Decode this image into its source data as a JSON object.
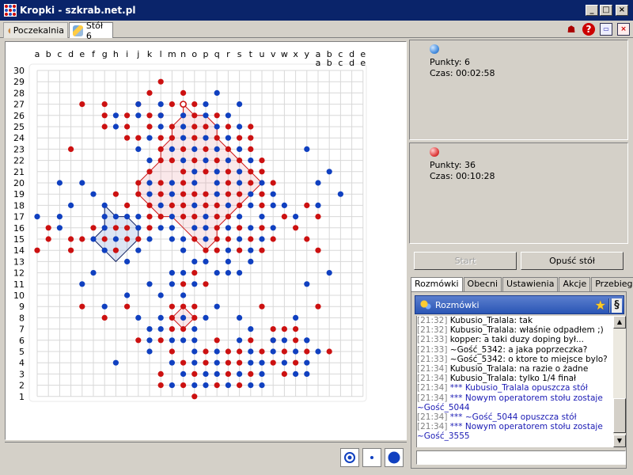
{
  "window": {
    "title": "Kropki - szkrab.net.pl",
    "minimize": "_",
    "maximize": "□",
    "close": "×"
  },
  "tabs": [
    {
      "label": "Poczekalnia"
    },
    {
      "label": "Stół 6"
    }
  ],
  "toolbar_icons": [
    "users-icon",
    "help-icon",
    "restore-window-icon",
    "close-window-icon"
  ],
  "board": {
    "columns": [
      "a",
      "b",
      "c",
      "d",
      "e",
      "f",
      "g",
      "h",
      "i",
      "j",
      "k",
      "l",
      "m",
      "n",
      "o",
      "p",
      "q",
      "r",
      "s",
      "t",
      "u",
      "v",
      "w",
      "x",
      "y",
      "a b",
      "b c",
      "c d",
      "d e",
      "e e"
    ],
    "col_top": [
      "a",
      "b",
      "c",
      "d",
      "e",
      "f",
      "g",
      "h",
      "i",
      "j",
      "k",
      "l",
      "m",
      "n",
      "o",
      "p",
      "q",
      "r",
      "s",
      "t",
      "u",
      "v",
      "w",
      "x",
      "y",
      "a",
      "b",
      "c",
      "d",
      "e"
    ],
    "col_bottom": [
      "",
      "",
      "",
      "",
      "",
      "",
      "",
      "",
      "",
      "",
      "",
      "",
      "",
      "",
      "",
      "",
      "",
      "",
      "",
      "",
      "",
      "",
      "",
      "",
      "",
      "a",
      "b",
      "c",
      "d",
      "e"
    ],
    "rows": [
      "30",
      "29",
      "28",
      "27",
      "26",
      "25",
      "24",
      "23",
      "22",
      "21",
      "20",
      "19",
      "18",
      "17",
      "16",
      "15",
      "14",
      "13",
      "12",
      "11",
      "10",
      "9",
      "8",
      "7",
      "6",
      "5",
      "4",
      "3",
      "2",
      "1"
    ],
    "colors": {
      "red": "#cc1111",
      "blue": "#1040c0",
      "grid": "#d8d8d8"
    },
    "red_dots": [
      [
        11,
        29
      ],
      [
        10,
        28
      ],
      [
        13,
        28
      ],
      [
        4,
        27
      ],
      [
        6,
        27
      ],
      [
        9,
        27
      ],
      [
        12,
        27
      ],
      [
        14,
        27
      ],
      [
        6,
        26
      ],
      [
        8,
        26
      ],
      [
        10,
        26
      ],
      [
        11,
        26
      ],
      [
        14,
        26
      ],
      [
        16,
        26
      ],
      [
        6,
        25
      ],
      [
        8,
        25
      ],
      [
        10,
        25
      ],
      [
        12,
        25
      ],
      [
        14,
        25
      ],
      [
        15,
        25
      ],
      [
        17,
        25
      ],
      [
        19,
        25
      ],
      [
        8,
        24
      ],
      [
        9,
        24
      ],
      [
        11,
        24
      ],
      [
        12,
        24
      ],
      [
        14,
        24
      ],
      [
        16,
        24
      ],
      [
        18,
        24
      ],
      [
        19,
        24
      ],
      [
        3,
        23
      ],
      [
        11,
        23
      ],
      [
        13,
        23
      ],
      [
        15,
        23
      ],
      [
        17,
        23
      ],
      [
        19,
        23
      ],
      [
        11,
        22
      ],
      [
        12,
        22
      ],
      [
        14,
        22
      ],
      [
        16,
        22
      ],
      [
        18,
        22
      ],
      [
        20,
        22
      ],
      [
        10,
        21
      ],
      [
        13,
        21
      ],
      [
        15,
        21
      ],
      [
        17,
        21
      ],
      [
        19,
        21
      ],
      [
        20,
        21
      ],
      [
        9,
        20
      ],
      [
        11,
        20
      ],
      [
        13,
        20
      ],
      [
        17,
        20
      ],
      [
        19,
        20
      ],
      [
        21,
        20
      ],
      [
        7,
        19
      ],
      [
        9,
        19
      ],
      [
        11,
        19
      ],
      [
        13,
        19
      ],
      [
        14,
        19
      ],
      [
        15,
        19
      ],
      [
        17,
        19
      ],
      [
        18,
        19
      ],
      [
        20,
        19
      ],
      [
        8,
        18
      ],
      [
        10,
        18
      ],
      [
        12,
        18
      ],
      [
        13,
        18
      ],
      [
        15,
        18
      ],
      [
        16,
        18
      ],
      [
        18,
        18
      ],
      [
        20,
        18
      ],
      [
        24,
        18
      ],
      [
        10,
        17
      ],
      [
        11,
        17
      ],
      [
        13,
        17
      ],
      [
        14,
        17
      ],
      [
        16,
        17
      ],
      [
        17,
        17
      ],
      [
        22,
        17
      ],
      [
        25,
        17
      ],
      [
        1,
        16
      ],
      [
        5,
        16
      ],
      [
        7,
        16
      ],
      [
        8,
        16
      ],
      [
        10,
        16
      ],
      [
        16,
        16
      ],
      [
        18,
        16
      ],
      [
        20,
        16
      ],
      [
        23,
        16
      ],
      [
        1,
        15
      ],
      [
        3,
        15
      ],
      [
        4,
        15
      ],
      [
        6,
        15
      ],
      [
        8,
        15
      ],
      [
        9,
        15
      ],
      [
        14,
        15
      ],
      [
        16,
        15
      ],
      [
        17,
        15
      ],
      [
        19,
        15
      ],
      [
        21,
        15
      ],
      [
        24,
        15
      ],
      [
        0,
        14
      ],
      [
        3,
        14
      ],
      [
        7,
        14
      ],
      [
        15,
        14
      ],
      [
        16,
        14
      ],
      [
        18,
        14
      ],
      [
        20,
        14
      ],
      [
        25,
        14
      ],
      [
        14,
        12
      ],
      [
        15,
        11
      ],
      [
        13,
        11
      ],
      [
        4,
        9
      ],
      [
        8,
        9
      ],
      [
        12,
        9
      ],
      [
        13,
        9
      ],
      [
        14,
        9
      ],
      [
        20,
        9
      ],
      [
        25,
        9
      ],
      [
        6,
        8
      ],
      [
        12,
        8
      ],
      [
        14,
        8
      ],
      [
        12,
        7
      ],
      [
        13,
        7
      ],
      [
        21,
        7
      ],
      [
        22,
        7
      ],
      [
        23,
        7
      ],
      [
        9,
        6
      ],
      [
        11,
        6
      ],
      [
        16,
        6
      ],
      [
        19,
        6
      ],
      [
        21,
        6
      ],
      [
        23,
        6
      ],
      [
        12,
        5
      ],
      [
        15,
        5
      ],
      [
        17,
        5
      ],
      [
        18,
        5
      ],
      [
        20,
        5
      ],
      [
        22,
        5
      ],
      [
        24,
        5
      ],
      [
        26,
        5
      ],
      [
        13,
        4
      ],
      [
        15,
        4
      ],
      [
        17,
        4
      ],
      [
        18,
        4
      ],
      [
        21,
        4
      ],
      [
        23,
        4
      ],
      [
        11,
        3
      ],
      [
        14,
        3
      ],
      [
        17,
        3
      ],
      [
        19,
        3
      ],
      [
        22,
        3
      ],
      [
        11,
        2
      ],
      [
        13,
        2
      ],
      [
        16,
        2
      ],
      [
        18,
        2
      ],
      [
        14,
        1
      ]
    ],
    "blue_dots": [
      [
        16,
        28
      ],
      [
        9,
        27
      ],
      [
        11,
        27
      ],
      [
        15,
        27
      ],
      [
        18,
        27
      ],
      [
        7,
        26
      ],
      [
        9,
        26
      ],
      [
        11,
        26
      ],
      [
        13,
        26
      ],
      [
        15,
        26
      ],
      [
        17,
        26
      ],
      [
        7,
        25
      ],
      [
        11,
        25
      ],
      [
        13,
        25
      ],
      [
        16,
        25
      ],
      [
        18,
        25
      ],
      [
        10,
        24
      ],
      [
        13,
        24
      ],
      [
        15,
        24
      ],
      [
        17,
        24
      ],
      [
        24,
        23
      ],
      [
        9,
        23
      ],
      [
        12,
        23
      ],
      [
        14,
        23
      ],
      [
        16,
        23
      ],
      [
        18,
        23
      ],
      [
        10,
        22
      ],
      [
        13,
        22
      ],
      [
        15,
        22
      ],
      [
        17,
        22
      ],
      [
        19,
        22
      ],
      [
        26,
        21
      ],
      [
        14,
        21
      ],
      [
        16,
        21
      ],
      [
        18,
        21
      ],
      [
        2,
        20
      ],
      [
        4,
        20
      ],
      [
        10,
        20
      ],
      [
        12,
        20
      ],
      [
        14,
        20
      ],
      [
        16,
        20
      ],
      [
        18,
        20
      ],
      [
        20,
        20
      ],
      [
        25,
        20
      ],
      [
        5,
        19
      ],
      [
        10,
        19
      ],
      [
        12,
        19
      ],
      [
        16,
        19
      ],
      [
        19,
        19
      ],
      [
        21,
        19
      ],
      [
        27,
        19
      ],
      [
        3,
        18
      ],
      [
        6,
        18
      ],
      [
        11,
        18
      ],
      [
        14,
        18
      ],
      [
        17,
        18
      ],
      [
        19,
        18
      ],
      [
        21,
        18
      ],
      [
        22,
        18
      ],
      [
        25,
        18
      ],
      [
        0,
        17
      ],
      [
        2,
        17
      ],
      [
        6,
        17
      ],
      [
        7,
        17
      ],
      [
        8,
        17
      ],
      [
        9,
        17
      ],
      [
        12,
        17
      ],
      [
        15,
        17
      ],
      [
        18,
        17
      ],
      [
        20,
        17
      ],
      [
        23,
        17
      ],
      [
        2,
        16
      ],
      [
        6,
        16
      ],
      [
        9,
        16
      ],
      [
        11,
        16
      ],
      [
        12,
        16
      ],
      [
        14,
        16
      ],
      [
        15,
        16
      ],
      [
        17,
        16
      ],
      [
        19,
        16
      ],
      [
        21,
        16
      ],
      [
        5,
        15
      ],
      [
        7,
        15
      ],
      [
        10,
        15
      ],
      [
        12,
        15
      ],
      [
        13,
        15
      ],
      [
        15,
        15
      ],
      [
        18,
        15
      ],
      [
        20,
        15
      ],
      [
        6,
        14
      ],
      [
        9,
        14
      ],
      [
        13,
        14
      ],
      [
        17,
        14
      ],
      [
        19,
        14
      ],
      [
        8,
        13
      ],
      [
        14,
        13
      ],
      [
        15,
        13
      ],
      [
        17,
        13
      ],
      [
        19,
        13
      ],
      [
        5,
        12
      ],
      [
        12,
        12
      ],
      [
        13,
        12
      ],
      [
        16,
        12
      ],
      [
        17,
        12
      ],
      [
        18,
        12
      ],
      [
        26,
        12
      ],
      [
        4,
        11
      ],
      [
        10,
        11
      ],
      [
        12,
        11
      ],
      [
        14,
        11
      ],
      [
        24,
        11
      ],
      [
        8,
        10
      ],
      [
        11,
        10
      ],
      [
        13,
        10
      ],
      [
        6,
        9
      ],
      [
        16,
        9
      ],
      [
        9,
        8
      ],
      [
        11,
        8
      ],
      [
        13,
        8
      ],
      [
        15,
        8
      ],
      [
        18,
        8
      ],
      [
        23,
        8
      ],
      [
        10,
        7
      ],
      [
        11,
        7
      ],
      [
        14,
        7
      ],
      [
        19,
        7
      ],
      [
        21,
        6
      ],
      [
        24,
        6
      ],
      [
        10,
        6
      ],
      [
        12,
        6
      ],
      [
        13,
        6
      ],
      [
        14,
        6
      ],
      [
        18,
        6
      ],
      [
        22,
        6
      ],
      [
        24,
        6
      ],
      [
        10,
        5
      ],
      [
        14,
        5
      ],
      [
        16,
        5
      ],
      [
        19,
        5
      ],
      [
        21,
        5
      ],
      [
        23,
        5
      ],
      [
        25,
        5
      ],
      [
        7,
        4
      ],
      [
        12,
        4
      ],
      [
        14,
        4
      ],
      [
        16,
        4
      ],
      [
        19,
        4
      ],
      [
        20,
        4
      ],
      [
        22,
        4
      ],
      [
        24,
        4
      ],
      [
        13,
        3
      ],
      [
        15,
        3
      ],
      [
        16,
        3
      ],
      [
        18,
        3
      ],
      [
        20,
        3
      ],
      [
        23,
        3
      ],
      [
        24,
        3
      ],
      [
        12,
        2
      ],
      [
        14,
        2
      ],
      [
        15,
        2
      ],
      [
        17,
        2
      ],
      [
        19,
        2
      ],
      [
        20,
        2
      ]
    ],
    "last_move": [
      13,
      27
    ],
    "red_region_1": [
      [
        13,
        27
      ],
      [
        14,
        26
      ],
      [
        15,
        26
      ],
      [
        16,
        25
      ],
      [
        16,
        24
      ],
      [
        17,
        23
      ],
      [
        18,
        22
      ],
      [
        19,
        21
      ],
      [
        20,
        20
      ],
      [
        19,
        19
      ],
      [
        18,
        18
      ],
      [
        17,
        17
      ],
      [
        16,
        16
      ],
      [
        16,
        15
      ],
      [
        15,
        14
      ],
      [
        14,
        15
      ],
      [
        13,
        16
      ],
      [
        12,
        17
      ],
      [
        11,
        17
      ],
      [
        10,
        18
      ],
      [
        9,
        19
      ],
      [
        9,
        20
      ],
      [
        10,
        21
      ],
      [
        11,
        22
      ],
      [
        11,
        23
      ],
      [
        12,
        24
      ],
      [
        12,
        25
      ],
      [
        13,
        26
      ]
    ],
    "red_region_2": [
      [
        13,
        9
      ],
      [
        14,
        8
      ],
      [
        13,
        7
      ],
      [
        12,
        8
      ]
    ],
    "blue_region": [
      [
        6,
        18
      ],
      [
        7,
        17
      ],
      [
        8,
        17
      ],
      [
        9,
        16
      ],
      [
        9,
        15
      ],
      [
        8,
        14
      ],
      [
        7,
        13
      ],
      [
        6,
        14
      ],
      [
        5,
        15
      ],
      [
        6,
        16
      ],
      [
        6,
        17
      ]
    ]
  },
  "player_blue": {
    "points_label": "Punkty: 6",
    "time_label": "Czas: 00:02:58",
    "color": "#4a90e0"
  },
  "player_red": {
    "points_label": "Punkty: 36",
    "time_label": "Czas: 00:10:28",
    "color": "#e04040"
  },
  "buttons": {
    "start": "Start",
    "leave": "Opuść stół"
  },
  "bottom_tabs": [
    {
      "label": "Rozmówki"
    },
    {
      "label": "Obecni"
    },
    {
      "label": "Ustawienia"
    },
    {
      "label": "Akcje"
    },
    {
      "label": "Przebieg"
    }
  ],
  "chat": {
    "header": "Rozmówki",
    "lines": [
      {
        "ts": "[21:32]",
        "text": " Kubusio_Tralala: tak",
        "type": "msg"
      },
      {
        "ts": "[21:32]",
        "text": " Kubusio_Tralala: właśnie odpadłem ;)",
        "type": "msg"
      },
      {
        "ts": "[21:33]",
        "text": " kopper: a taki duzy doping był...",
        "type": "msg"
      },
      {
        "ts": "[21:33]",
        "text": " ~Gość_5342: a jaka poprzeczka?",
        "type": "msg"
      },
      {
        "ts": "[21:33]",
        "text": " ~Gość_5342: o ktore to miejsce bylo?",
        "type": "msg"
      },
      {
        "ts": "[21:34]",
        "text": " Kubusio_Tralala: na razie o żadne",
        "type": "msg"
      },
      {
        "ts": "[21:34]",
        "text": " Kubusio_Tralala: tylko 1/4 finał",
        "type": "msg"
      },
      {
        "ts": "[21:34]",
        "text": " *** Kubusio_Tralala opuszcza stół",
        "type": "sys"
      },
      {
        "ts": "[21:34]",
        "text": " *** Nowym operatorem stołu zostaje",
        "type": "sys"
      },
      {
        "ts": "",
        "text": "~Gość_5044",
        "type": "sys"
      },
      {
        "ts": "[21:34]",
        "text": " *** ~Gość_5044 opuszcza stół",
        "type": "sys"
      },
      {
        "ts": "[21:34]",
        "text": " *** Nowym operatorem stołu zostaje",
        "type": "sys"
      },
      {
        "ts": "",
        "text": "~Gość_3555",
        "type": "sys"
      }
    ]
  }
}
